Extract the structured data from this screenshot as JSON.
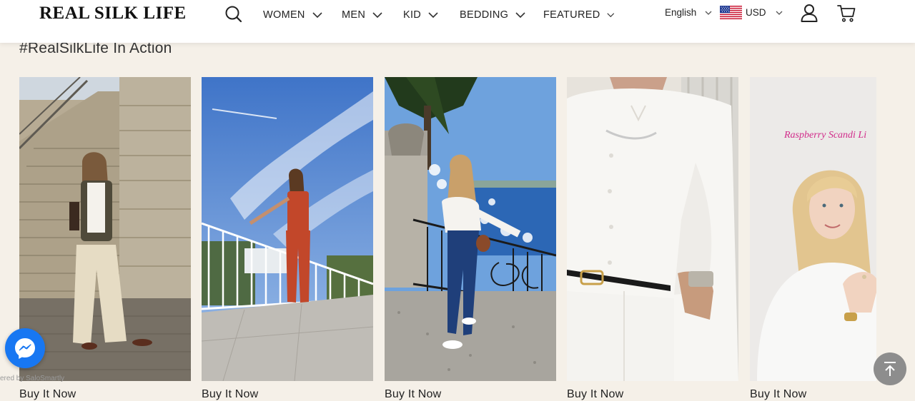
{
  "header": {
    "logo": "REAL SILK LIFE",
    "nav": [
      "WOMEN",
      "MEN",
      "KID",
      "BEDDING",
      "FEATURED"
    ],
    "language": "English",
    "currency": "USD"
  },
  "section": {
    "title": "#RealSilkLife In Action",
    "cards": [
      {
        "cta": "Buy It Now"
      },
      {
        "cta": "Buy It Now"
      },
      {
        "cta": "Buy It Now"
      },
      {
        "cta": "Buy It Now"
      },
      {
        "cta": "Buy It Now",
        "overlay_text": "Raspberry Scandi Li"
      }
    ],
    "powered_by": "ered by SaloSmartly"
  },
  "colors": {
    "background": "#f5f0e8",
    "header": "#ffffff",
    "messenger": "#1877f2",
    "back_to_top": "#8d8d8d"
  },
  "icons": [
    "search-icon",
    "chevron-down-icon",
    "us-flag-icon",
    "user-icon",
    "cart-icon",
    "messenger-icon",
    "arrow-up-icon"
  ]
}
